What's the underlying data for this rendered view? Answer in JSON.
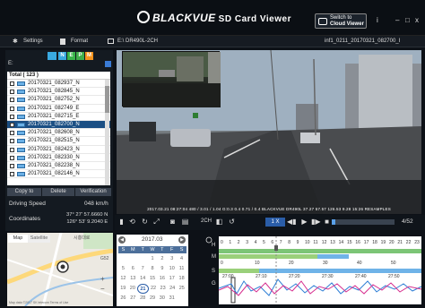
{
  "app": {
    "brand": "BLACKVUE",
    "subtitle": "SD Card Viewer"
  },
  "cloud_button": {
    "line1": "Switch to",
    "line2": "Cloud Viewer"
  },
  "window_controls": {
    "info": "i",
    "min": "–",
    "max": "□",
    "close": "x"
  },
  "toolbar": {
    "settings": "Settings",
    "format": "Format",
    "model": "E:\\ DR490L-2CH",
    "filename": "inf1_0211_20170321_082700_I"
  },
  "view_tabs": [
    "N",
    "E",
    "P",
    "M"
  ],
  "colors": {
    "tab_n": "#3aa9e0",
    "tab_e": "#39b54a",
    "tab_p": "#3fae49",
    "tab_m": "#f7941d",
    "accent": "#2a5da8"
  },
  "drive": "E:",
  "file_list": {
    "header": "Total ( 123 )",
    "items": [
      {
        "name": "20170321_082937_N",
        "selected": false
      },
      {
        "name": "20170321_082845_N",
        "selected": false
      },
      {
        "name": "20170321_082752_N",
        "selected": false
      },
      {
        "name": "20170321_082749_E",
        "selected": false
      },
      {
        "name": "20170321_082715_E",
        "selected": false
      },
      {
        "name": "20170321_082700_N",
        "selected": true
      },
      {
        "name": "20170321_082608_N",
        "selected": false
      },
      {
        "name": "20170321_082515_N",
        "selected": false
      },
      {
        "name": "20170321_082423_N",
        "selected": false
      },
      {
        "name": "20170321_082330_N",
        "selected": false
      },
      {
        "name": "20170321_082238_N",
        "selected": false
      },
      {
        "name": "20170321_082146_N",
        "selected": false
      }
    ]
  },
  "actions": {
    "copy": "Copy to",
    "delete": "Delete",
    "verify": "Verification"
  },
  "driving": {
    "speed_label": "Driving Speed",
    "speed_value": "048 km/h",
    "coord_label": "Coordinates",
    "lat": "37° 27' 57.6660 N",
    "lon": "126° 53' 9.2040 E"
  },
  "video": {
    "hud": "2017.03.21   08:27:04    480 / 3.01 / 1.04   G:0.3   0.4   0.71 / 0.4   BLACKVUE   DR490L   37.27   57.57   126.53   9.28   15:26   RESAMPLES",
    "progress": 0.05
  },
  "controls": {
    "zoom": "1 X",
    "page": "4/52",
    "mode": "2CH"
  },
  "map": {
    "tab_map": "Map",
    "tab_satellite": "Satellite",
    "zoom_in": "+",
    "zoom_out": "−",
    "credit": "Map data ©2017 SK telecom  Terms of Use",
    "street1": "시흥대로",
    "street2": "G52"
  },
  "calendar": {
    "month": "2017.03",
    "weekdays": [
      "S",
      "M",
      "T",
      "W",
      "T",
      "F",
      "S"
    ],
    "weeks": [
      [
        "",
        "",
        "",
        "1",
        "2",
        "3",
        "4"
      ],
      [
        "5",
        "6",
        "7",
        "8",
        "9",
        "10",
        "11"
      ],
      [
        "12",
        "13",
        "14",
        "15",
        "16",
        "17",
        "18"
      ],
      [
        "19",
        "20",
        "21",
        "22",
        "23",
        "24",
        "25"
      ],
      [
        "26",
        "27",
        "28",
        "29",
        "30",
        "31",
        ""
      ]
    ],
    "selected": "21"
  },
  "timeline": {
    "hours": [
      "0",
      "1",
      "2",
      "3",
      "4",
      "5",
      "6",
      "7",
      "8",
      "9",
      "10",
      "11",
      "12",
      "13",
      "14",
      "15",
      "16",
      "17",
      "18",
      "19",
      "20",
      "21",
      "22",
      "23"
    ],
    "min_labels": [
      "0",
      "10",
      "20",
      "30",
      "40",
      "50"
    ],
    "sec_labels": [
      "27:00",
      "27:10",
      "27:20",
      "27:30",
      "27:40",
      "27:50"
    ],
    "row_labels": {
      "h": "H",
      "m": "M",
      "s": "S",
      "g": "G"
    }
  }
}
